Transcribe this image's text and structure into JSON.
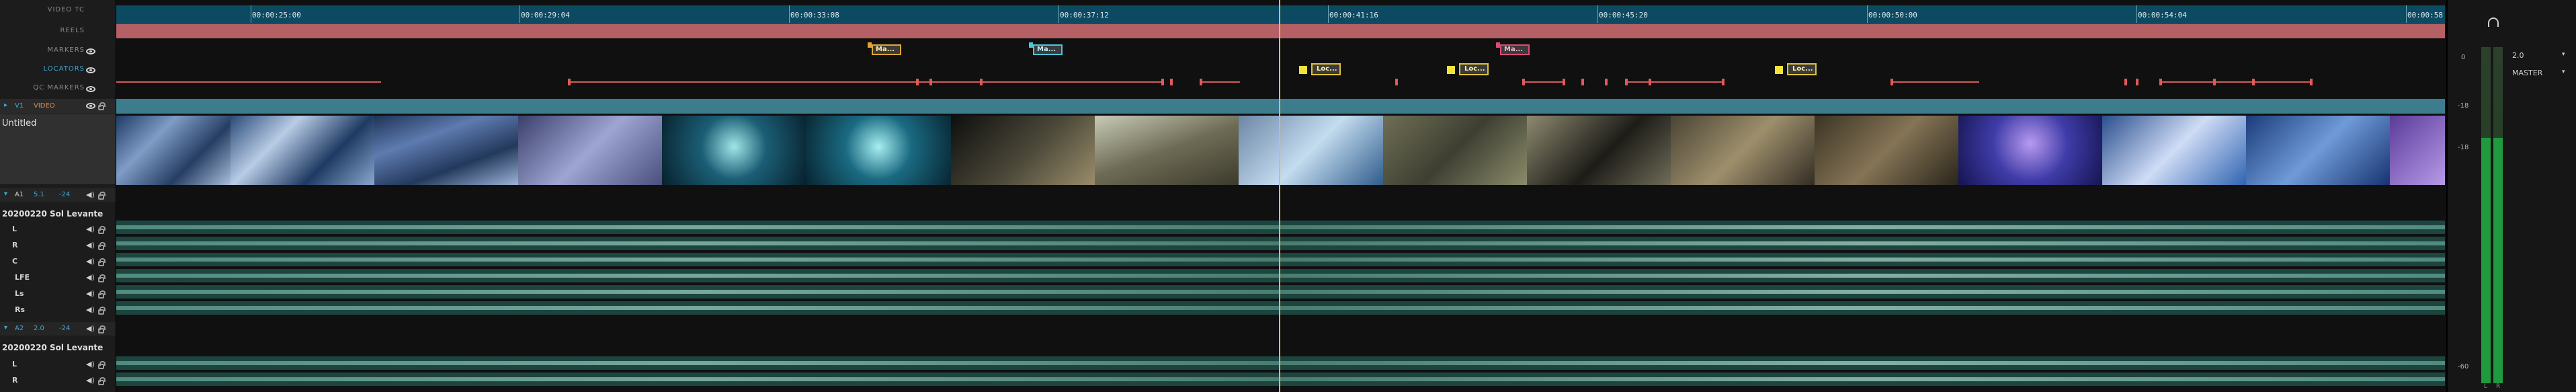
{
  "header": {
    "rows": [
      "VIDEO TC",
      "REELS",
      "MARKERS",
      "LOCATORS",
      "QC MARKERS"
    ],
    "video_track": {
      "label": "V1",
      "name": "VIDEO",
      "clip_name": "Untitled"
    },
    "audio_tracks": [
      {
        "id": "A1",
        "col2": "5.1",
        "col3": "-24",
        "name": "20200220 Sol Levante",
        "channels": [
          "L",
          "R",
          "C",
          "LFE",
          "Ls",
          "Rs"
        ]
      },
      {
        "id": "A2",
        "col2": "2.0",
        "col3": "-24",
        "name": "20200220 Sol Levante",
        "channels": [
          "L",
          "R"
        ]
      }
    ]
  },
  "ruler": {
    "timecodes": [
      "00:00:25:00",
      "00:00:29:04",
      "00:00:33:08",
      "00:00:37:12",
      "00:00:41:16",
      "00:00:45:20",
      "00:00:50:00",
      "00:00:54:04",
      "00:00:58"
    ]
  },
  "markers": [
    {
      "label": "Ma...",
      "color": "#e0a832"
    },
    {
      "label": "Ma...",
      "color": "#4fc3d9"
    },
    {
      "label": "Ma...",
      "color": "#d94c7a"
    }
  ],
  "locators": [
    {
      "label": "Loc..."
    },
    {
      "label": "Loc..."
    },
    {
      "label": "Loc..."
    }
  ],
  "right_panel": {
    "icon": "headphones-icon",
    "channel_select": "2.0",
    "bus_select": "MASTER",
    "scale": [
      "0",
      "-18",
      "-18",
      "-60"
    ],
    "footer": [
      "L",
      "R"
    ]
  },
  "colors": {
    "ruler": "#0b4a60",
    "reel": "#b46064",
    "video_bar": "#3d7c8c",
    "audio": "#1c453f",
    "playhead": "#e6c22a"
  }
}
